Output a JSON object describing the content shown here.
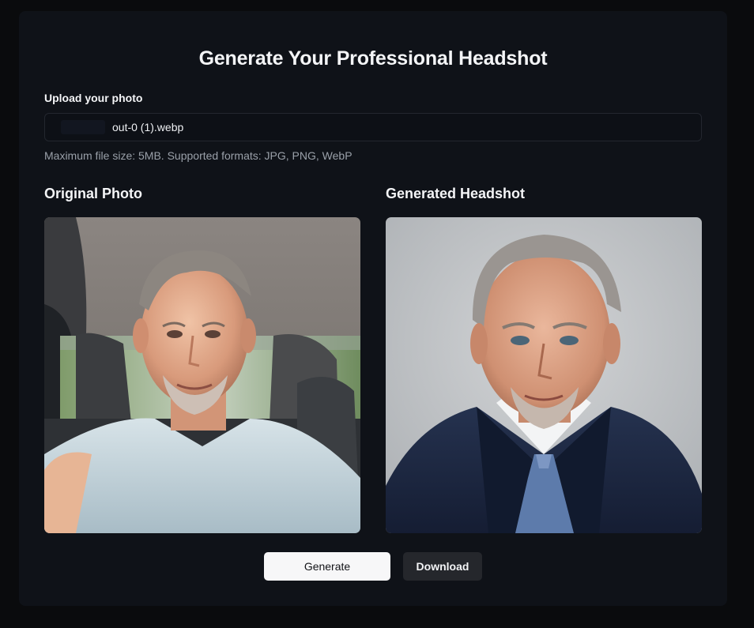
{
  "page": {
    "title": "Generate Your Professional Headshot"
  },
  "upload": {
    "label": "Upload your photo",
    "file_name": "out-0 (1).webp",
    "hint": "Maximum file size: 5MB. Supported formats: JPG, PNG, WebP"
  },
  "original": {
    "title": "Original Photo",
    "image_alt": "Selfie of a man in a car"
  },
  "generated": {
    "title": "Generated Headshot",
    "image_alt": "Professional headshot of a man in a suit"
  },
  "actions": {
    "generate_label": "Generate",
    "download_label": "Download"
  },
  "colors": {
    "background": "#0a0b0d",
    "card": "#0f1218",
    "primary_button": "#f7f7f8",
    "secondary_button": "#25272c"
  }
}
